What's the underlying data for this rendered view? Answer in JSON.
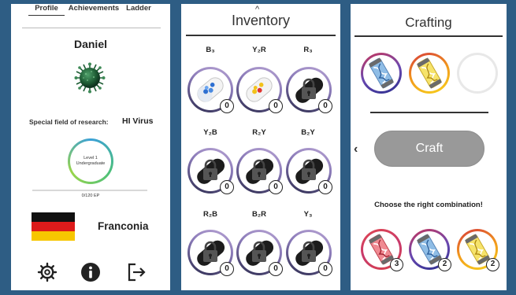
{
  "profile": {
    "tabs": [
      "Profile",
      "Achievements",
      "Ladder"
    ],
    "active_tab": "Profile",
    "username": "Daniel",
    "field_label": "Special field of research:",
    "field_value": "HI Virus",
    "level_line1": "Level 1",
    "level_line2": "Undergraduate",
    "ep_progress": 0,
    "ep_text": "0/120 EP",
    "country_flag": "germany-flag",
    "region": "Franconia",
    "footer_icons": [
      "gear-icon",
      "info-icon",
      "logout-icon"
    ]
  },
  "inventory": {
    "title": "Inventory",
    "items": [
      {
        "label": "B₃",
        "count": "0",
        "state": "blue-capsule"
      },
      {
        "label": "Y₂R",
        "count": "0",
        "state": "yellow-red-capsule"
      },
      {
        "label": "R₃",
        "count": "0",
        "state": "locked"
      },
      {
        "label": "Y₂B",
        "count": "0",
        "state": "locked"
      },
      {
        "label": "R₂Y",
        "count": "0",
        "state": "locked"
      },
      {
        "label": "B₂Y",
        "count": "0",
        "state": "locked"
      },
      {
        "label": "R₂B",
        "count": "0",
        "state": "locked"
      },
      {
        "label": "B₂R",
        "count": "0",
        "state": "locked"
      },
      {
        "label": "Y₃",
        "count": "0",
        "state": "locked"
      }
    ]
  },
  "crafting": {
    "title": "Crafting",
    "slots": [
      "blue-dna-capsule",
      "yellow-dna-capsule",
      "empty"
    ],
    "craft_label": "Craft",
    "prompt": "Choose the right combination!",
    "resources": [
      {
        "type": "red-dna-capsule",
        "count": "3"
      },
      {
        "type": "blue-dna-capsule",
        "count": "2"
      },
      {
        "type": "yellow-dna-capsule",
        "count": "2"
      }
    ]
  },
  "colors": {
    "background": "#2e5d84",
    "craft_button": "#999999"
  }
}
